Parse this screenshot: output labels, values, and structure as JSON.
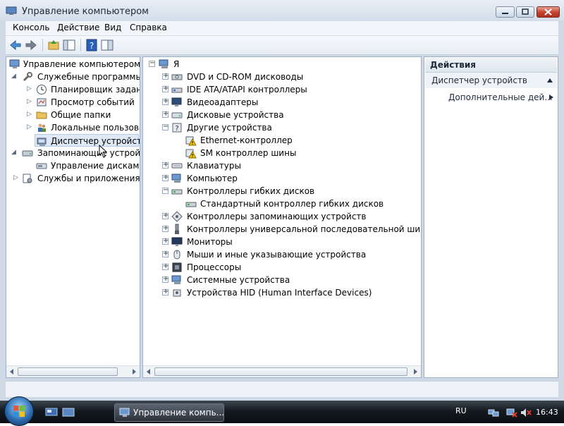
{
  "window": {
    "title": "Управление компьютером"
  },
  "menu": [
    "Консоль",
    "Действие",
    "Вид",
    "Справка"
  ],
  "left_tree": [
    {
      "label": "Управление компьютером (л",
      "icon": "computer-management-icon"
    },
    {
      "label": "Служебные программы",
      "icon": "tools-icon"
    },
    {
      "label": "Планировщик заданий",
      "icon": "clock-icon"
    },
    {
      "label": "Просмотр событий",
      "icon": "event-viewer-icon"
    },
    {
      "label": "Общие папки",
      "icon": "folder-icon"
    },
    {
      "label": "Локальные пользовате",
      "icon": "users-icon"
    },
    {
      "label": "Диспетчер устройств",
      "icon": "device-manager-icon"
    },
    {
      "label": "Запоминающие устройст",
      "icon": "storage-icon"
    },
    {
      "label": "Управление дисками",
      "icon": "disk-management-icon"
    },
    {
      "label": "Службы и приложения",
      "icon": "services-icon"
    }
  ],
  "device_tree": {
    "root": "Я",
    "items": [
      "DVD и CD-ROM дисководы",
      "IDE ATA/ATAPI контроллеры",
      "Видеоадаптеры",
      "Дисковые устройства",
      "Другие устройства",
      "Ethernet-контроллер",
      "SM контроллер шины",
      "Клавиатуры",
      "Компьютер",
      "Контроллеры гибких дисков",
      "Стандартный контроллер гибких дисков",
      "Контроллеры запоминающих устройств",
      "Контроллеры универсальной последовательной шины USB",
      "Мониторы",
      "Мыши и иные указывающие устройства",
      "Процессоры",
      "Системные устройства",
      "Устройства HID (Human Interface Devices)"
    ]
  },
  "actions": {
    "header": "Действия",
    "section": "Диспетчер устройств",
    "more": "Дополнительные дей..."
  },
  "taskbar": {
    "task_label": "Управление компь...",
    "language": "RU",
    "time": "16:43"
  },
  "colors": {
    "selection": "#dfe9f6",
    "window_frame": "#cfd9e6",
    "warning": "#f2c200"
  }
}
